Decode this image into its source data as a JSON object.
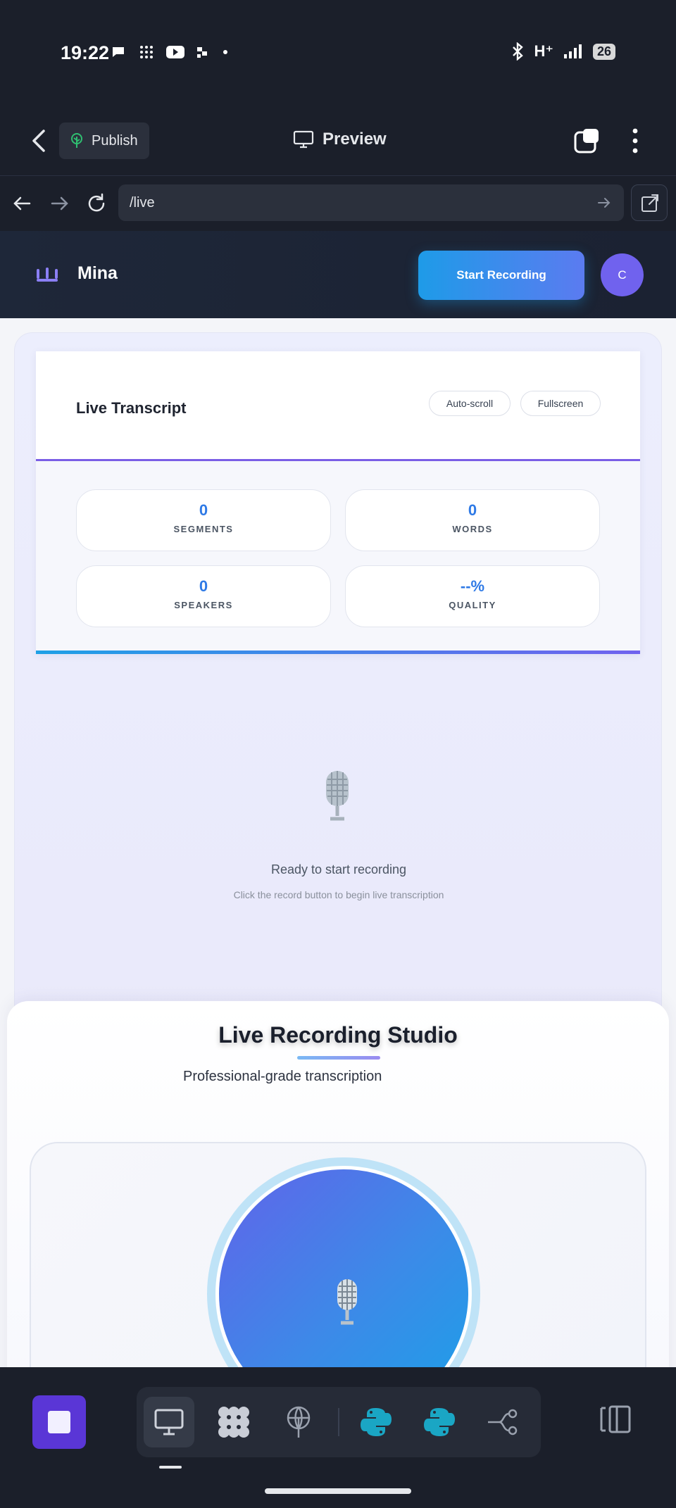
{
  "status_bar": {
    "time": "19:22",
    "network": "H⁺",
    "battery": "26"
  },
  "topbar": {
    "publish_label": "Publish",
    "preview_label": "Preview"
  },
  "urlbar": {
    "url": "/live"
  },
  "app": {
    "brand": "Mina",
    "start_recording_label": "Start Recording",
    "avatar_initial": "C"
  },
  "transcript": {
    "title": "Live Transcript",
    "auto_scroll_label": "Auto-scroll",
    "fullscreen_label": "Fullscreen",
    "stats": [
      {
        "value": "0",
        "label": "SEGMENTS"
      },
      {
        "value": "0",
        "label": "WORDS"
      },
      {
        "value": "0",
        "label": "SPEAKERS"
      },
      {
        "value": "--%",
        "label": "QUALITY"
      }
    ],
    "empty_title": "Ready to start recording",
    "empty_subtitle": "Click the record button to begin live transcription"
  },
  "studio": {
    "title": "Live Recording Studio",
    "subtitle": "Professional-grade transcription"
  },
  "bottom_nav": {
    "tools": [
      "monitor-icon",
      "grid-blob-icon",
      "antenna-icon",
      "python-icon",
      "python-icon",
      "share-flow-icon"
    ]
  },
  "colors": {
    "accent_purple": "#7062ee",
    "accent_blue": "#1e9be8",
    "stat_value": "#2f7ae6",
    "python_teal": "#1aa6c4"
  }
}
